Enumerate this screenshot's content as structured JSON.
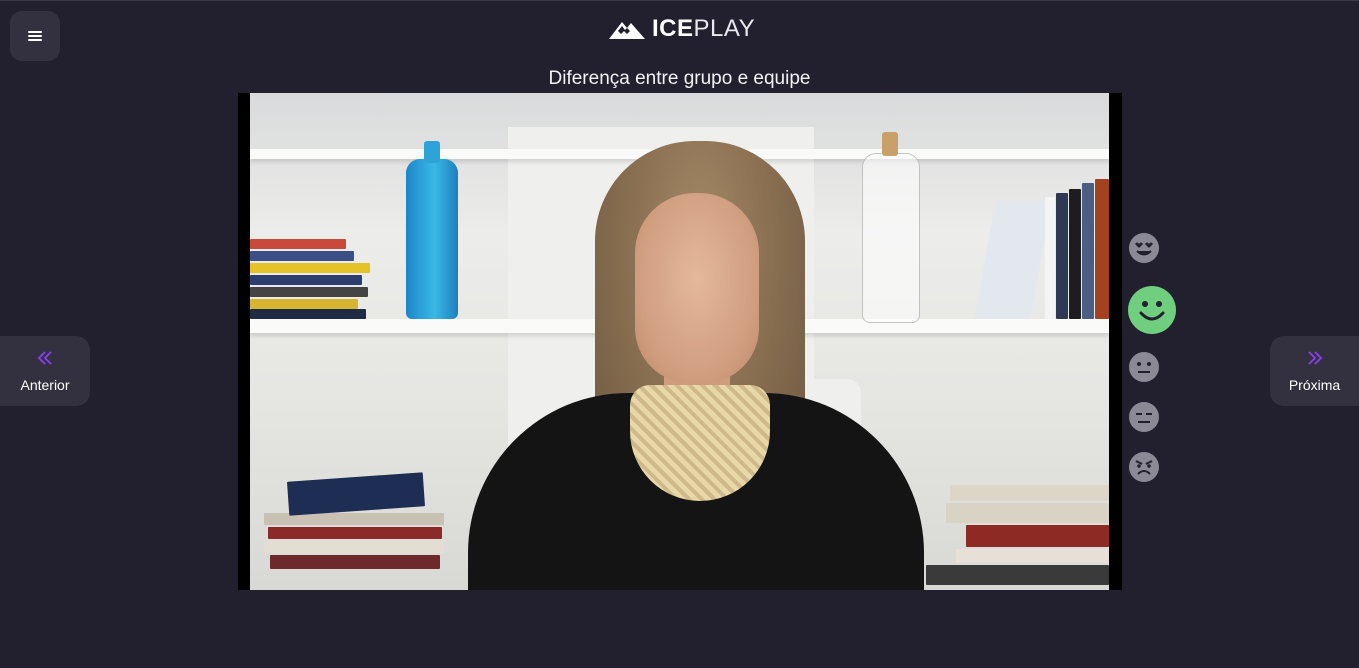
{
  "header": {
    "logo_bold": "ICE",
    "logo_light": "PLAY"
  },
  "menu": {
    "icon": "hamburger-menu-icon"
  },
  "video": {
    "title": "Diferença entre grupo e equipe"
  },
  "navigation": {
    "previous_label": "Anterior",
    "next_label": "Próxima",
    "previous_icon": "double-chevron-left-icon",
    "next_icon": "double-chevron-right-icon"
  },
  "reactions": {
    "items": [
      "love-face-icon",
      "smile-face-icon",
      "neutral-face-icon",
      "unamused-face-icon",
      "angry-face-icon"
    ],
    "selected": "smile-face-icon",
    "selected_color": "#6fcf7f",
    "default_color": "#8b8996"
  },
  "colors": {
    "background": "#221f2e",
    "button": "#33313f",
    "accent": "#8a3ff2"
  }
}
